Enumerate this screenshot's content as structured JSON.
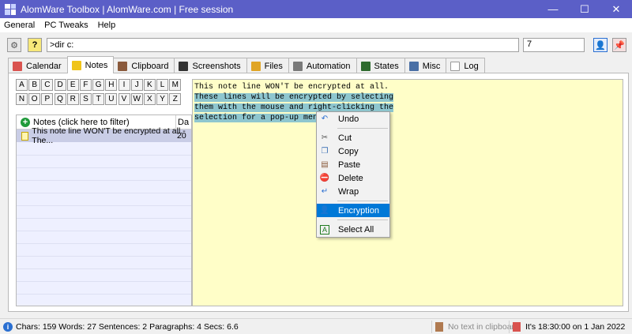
{
  "window": {
    "title": "AlomWare Toolbox  |  AlomWare.com  |  Free session",
    "minimize": "—",
    "maximize": "☐",
    "close": "✕"
  },
  "menu": [
    "General",
    "PC Tweaks",
    "Help"
  ],
  "command": {
    "value": ">dir c:",
    "count": "7"
  },
  "tabs": [
    {
      "label": "Calendar",
      "icon": "calendar-icon",
      "color": "#d9534f"
    },
    {
      "label": "Notes",
      "icon": "notes-icon",
      "color": "#f0c419"
    },
    {
      "label": "Clipboard",
      "icon": "clipboard-icon",
      "color": "#8a5a3c"
    },
    {
      "label": "Screenshots",
      "icon": "screenshots-icon",
      "color": "#333333"
    },
    {
      "label": "Files",
      "icon": "files-icon",
      "color": "#e0a526"
    },
    {
      "label": "Automation",
      "icon": "automation-icon",
      "color": "#7a7a7a"
    },
    {
      "label": "States",
      "icon": "states-icon",
      "color": "#2f6b2f"
    },
    {
      "label": "Misc",
      "icon": "misc-icon",
      "color": "#4a6fa5"
    },
    {
      "label": "Log",
      "icon": "log-icon",
      "color": "#ffffff"
    }
  ],
  "letters": {
    "row1": [
      "A",
      "B",
      "C",
      "D",
      "E",
      "F",
      "G",
      "H",
      "I",
      "J",
      "K",
      "L",
      "M"
    ],
    "row2": [
      "N",
      "O",
      "P",
      "Q",
      "R",
      "S",
      "T",
      "U",
      "V",
      "W",
      "X",
      "Y",
      "Z"
    ]
  },
  "notes_list": {
    "header": "Notes  (click here to filter)",
    "header_col2": "Da",
    "rows": [
      {
        "text": "This note line WON'T be encrypted at all.-The...",
        "date": "20"
      }
    ]
  },
  "editor": {
    "lines": [
      "This note line WON'T be encrypted at all.",
      "These lines will be encrypted by selecting",
      "them with the mouse and right-clicking the",
      "selection for a pop-up menu."
    ]
  },
  "context_menu": {
    "items": [
      {
        "label": "Undo",
        "icon": "undo-icon",
        "glyph": "↶",
        "color": "#2a6fd1"
      },
      {
        "sep": true
      },
      {
        "label": "Cut",
        "icon": "cut-icon",
        "glyph": "✂",
        "color": "#555555"
      },
      {
        "label": "Copy",
        "icon": "copy-icon",
        "glyph": "❐",
        "color": "#3a6fb5"
      },
      {
        "label": "Paste",
        "icon": "paste-icon",
        "glyph": "▤",
        "color": "#8a5a3c"
      },
      {
        "label": "Delete",
        "icon": "delete-icon",
        "glyph": "⛔",
        "color": "#d9232e"
      },
      {
        "label": "Wrap",
        "icon": "wrap-icon",
        "glyph": "↵",
        "color": "#2a6fd1"
      },
      {
        "sep": true
      },
      {
        "label": "Encryption",
        "icon": "encryption-icon",
        "glyph": "👤",
        "color": "#ffffff",
        "highlight": true
      },
      {
        "sep": true
      },
      {
        "label": "Select All",
        "icon": "select-all-icon",
        "glyph": "A",
        "color": "#1f7a1f"
      }
    ]
  },
  "status": {
    "stats": "Chars: 159  Words: 27  Sentences: 2  Paragraphs: 4  Secs: 6.6",
    "clipboard": "No text in clipboard",
    "time": "It's 18:30:00 on 1 Jan 2022"
  }
}
